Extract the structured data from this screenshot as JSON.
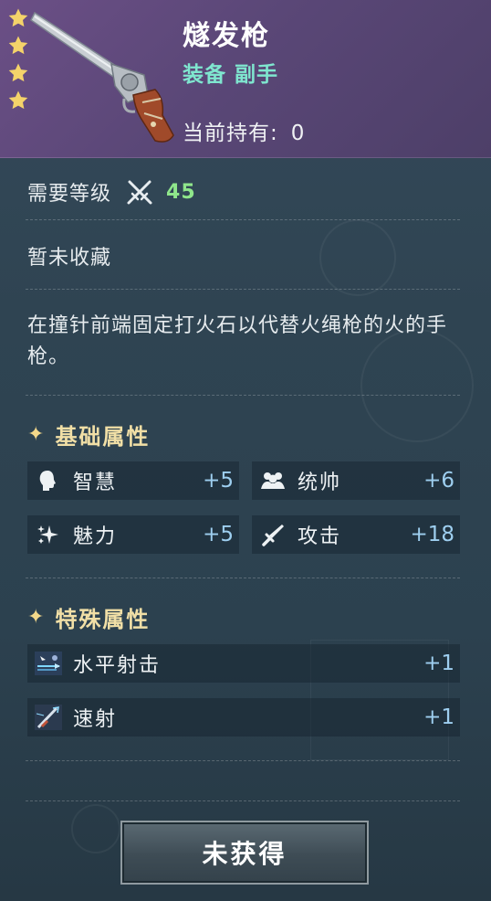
{
  "item": {
    "name": "燧发枪",
    "type": "装备 副手",
    "holding_label": "当前持有:",
    "holding_value": "0",
    "stars": 4,
    "star_color": "#f4d36a"
  },
  "level": {
    "label": "需要等级",
    "icon": "crossed-swords-icon",
    "value": "45",
    "value_color": "#8fe68b"
  },
  "collection_status": "暂未收藏",
  "description": "在撞针前端固定打火石以代替火绳枪的火的手枪。",
  "basic": {
    "title": "基础属性",
    "attrs": [
      {
        "icon": "head-icon",
        "label": "智慧",
        "value": "+5"
      },
      {
        "icon": "people-icon",
        "label": "统帅",
        "value": "+6"
      },
      {
        "icon": "sparkle-icon",
        "label": "魅力",
        "value": "+5"
      },
      {
        "icon": "sword-icon",
        "label": "攻击",
        "value": "+18"
      }
    ]
  },
  "special": {
    "title": "特殊属性",
    "attrs": [
      {
        "icon": "horizontal-shot-icon",
        "label": "水平射击",
        "value": "+1"
      },
      {
        "icon": "rapid-fire-icon",
        "label": "速射",
        "value": "+1"
      }
    ]
  },
  "action": {
    "button_label": "未获得"
  }
}
